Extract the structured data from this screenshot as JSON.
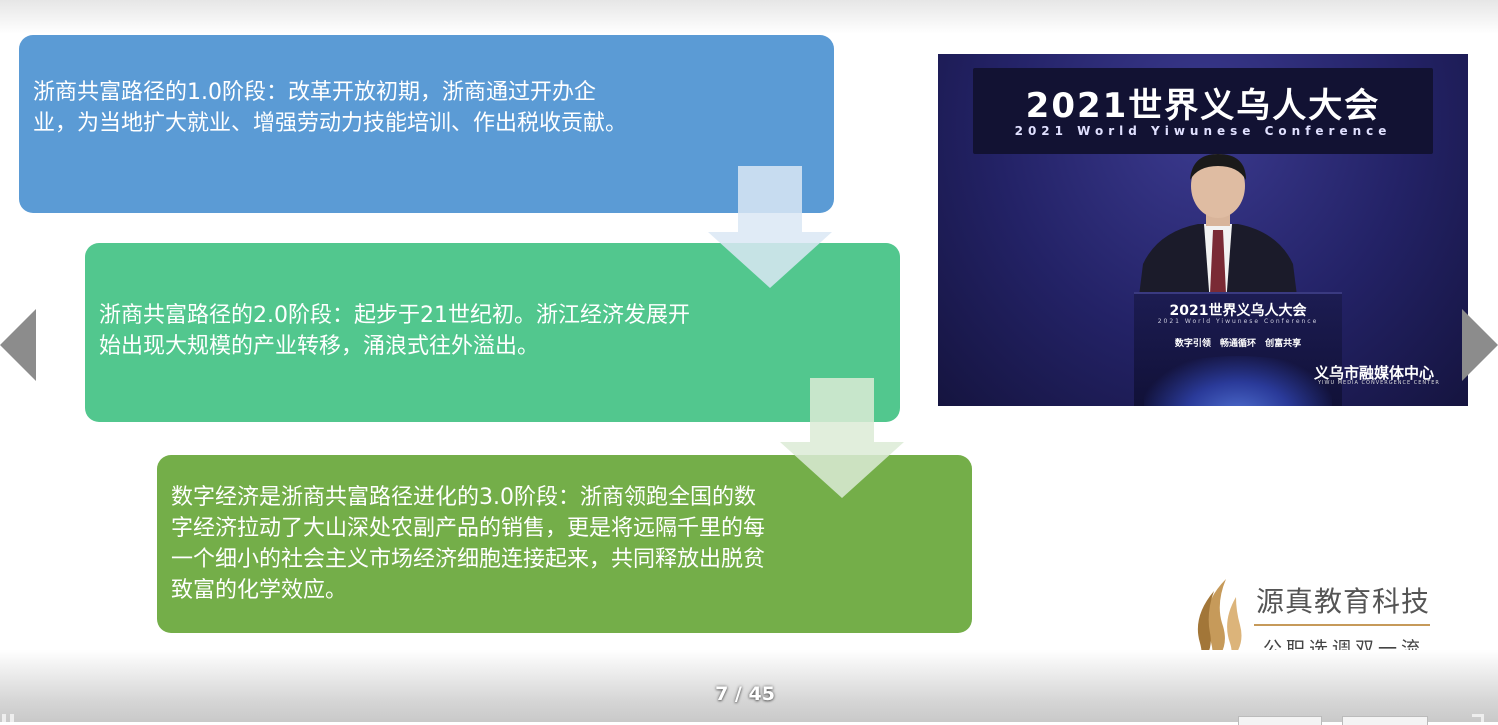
{
  "slide": {
    "stage1": "浙商共富路径的1.0阶段：改革开放初期，浙商通过开办企业，为当地扩大就业、增强劳动力技能培训、作出税收贡献。",
    "stage2": "浙商共富路径的2.0阶段：起步于21世纪初。浙江经济发展开始出现大规模的产业转移，涌浪式往外溢出。",
    "stage3": "数字经济是浙商共富路径进化的3.0阶段：浙商领跑全国的数字经济拉动了大山深处农副产品的销售，更是将远隔千里的每一个细小的社会主义市场经济细胞连接起来，共同释放出脱贫致富的化学效应。"
  },
  "photo": {
    "banner_title": "2021世界义乌人大会",
    "banner_subtitle": "2021 World Yiwunese Conference",
    "podium_title": "2021世界义乌人大会",
    "podium_subtitle": "2021 World Yiwunese Conference",
    "podium_slogan": "数字引领 畅通循环 创富共享",
    "watermark": "义乌市融媒体中心",
    "watermark_subtitle": "YIWU MEDIA CONVERGENCE CENTER"
  },
  "logo": {
    "name": "源真教育科技",
    "slogan": "公职选调双一流"
  },
  "viewer": {
    "page_counter": "7 / 45"
  },
  "colors": {
    "box1": "#5b9bd5",
    "box2": "#52c78e",
    "box3": "#74ae49",
    "logo_gold": "#c69a5a"
  }
}
